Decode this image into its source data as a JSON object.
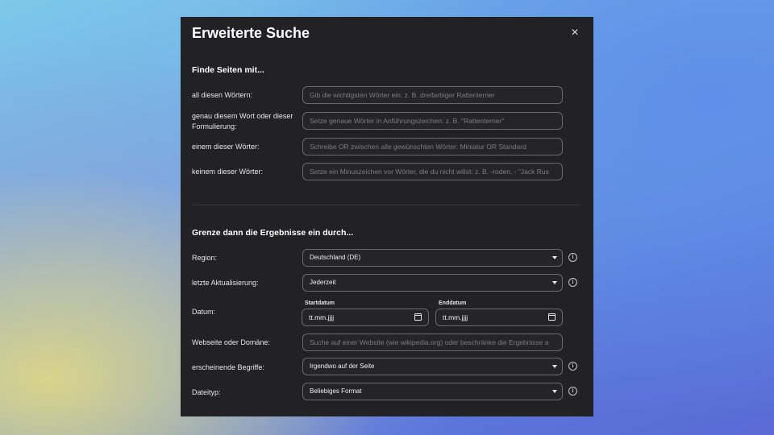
{
  "dialog": {
    "title": "Erweiterte Suche",
    "close_icon": "×"
  },
  "find": {
    "heading": "Finde Seiten mit...",
    "all_words": {
      "label": "all diesen Wörtern:",
      "placeholder": "Gib die wichtigsten Wörter ein: z. B. dreifarbiger Rattenterrier"
    },
    "exact_phrase": {
      "label": "genau diesem Wort oder dieser Formulierung:",
      "placeholder": "Setze genaue Wörter in Anführungszeichen: z. B. \"Rattenterrier\""
    },
    "any_words": {
      "label": "einem dieser Wörter:",
      "placeholder": "Schreibe OR zwischen alle gewünschten Wörter: Miniatur OR Standard"
    },
    "none_words": {
      "label": "keinem dieser Wörter:",
      "placeholder": "Setze ein Minuszeichen vor Wörter, die du nicht willst: z. B. -roden, - \"Jack Rus"
    }
  },
  "narrow": {
    "heading": "Grenze dann die Ergebnisse ein durch...",
    "region": {
      "label": "Region:",
      "value": "Deutschland (DE)"
    },
    "last_update": {
      "label": "letzte Aktualisierung:",
      "value": "Jederzeit"
    },
    "date": {
      "label": "Datum:",
      "start_caption": "Startdatum",
      "start_value": "tt.mm.jjjj",
      "end_caption": "Enddatum",
      "end_value": "tt.mm.jjjj"
    },
    "site": {
      "label": "Webseite oder Domäne:",
      "placeholder": "Suche auf einer Website (wie wikipedia.org) oder beschränke die Ergebnisse a"
    },
    "terms": {
      "label": "erscheinende Begriffe:",
      "value": "Irgendwo auf der Seite"
    },
    "filetype": {
      "label": "Dateityp:",
      "value": "Beliebiges Format"
    },
    "info_icon": "i"
  }
}
